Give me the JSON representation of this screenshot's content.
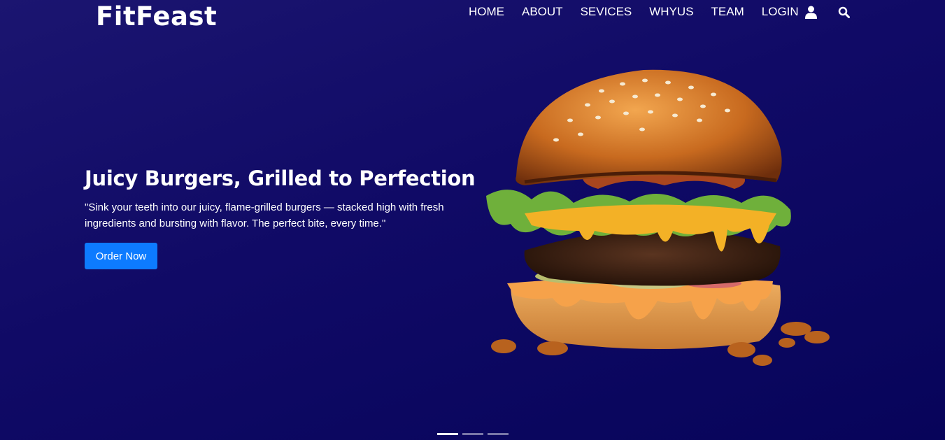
{
  "brand": {
    "name": "FitFeast"
  },
  "nav": {
    "home": "HOME",
    "about": "ABOUT",
    "services": "SEVICES",
    "whyus": "WHYUS",
    "team": "TEAM",
    "login": "LOGIN"
  },
  "icons": {
    "user": "user-icon",
    "search": "search-icon"
  },
  "hero": {
    "title": "Juicy Burgers, Grilled to Perfection",
    "text": "\"Sink your teeth into our juicy, flame-grilled burgers — stacked high with fresh ingredients and bursting with flavor. The perfect bite, every time.\"",
    "button": "Order Now",
    "image": "burger-image"
  },
  "carousel": {
    "slides": 3,
    "active": 1
  },
  "colors": {
    "accent": "#0d7bff",
    "background": "#100a66"
  }
}
